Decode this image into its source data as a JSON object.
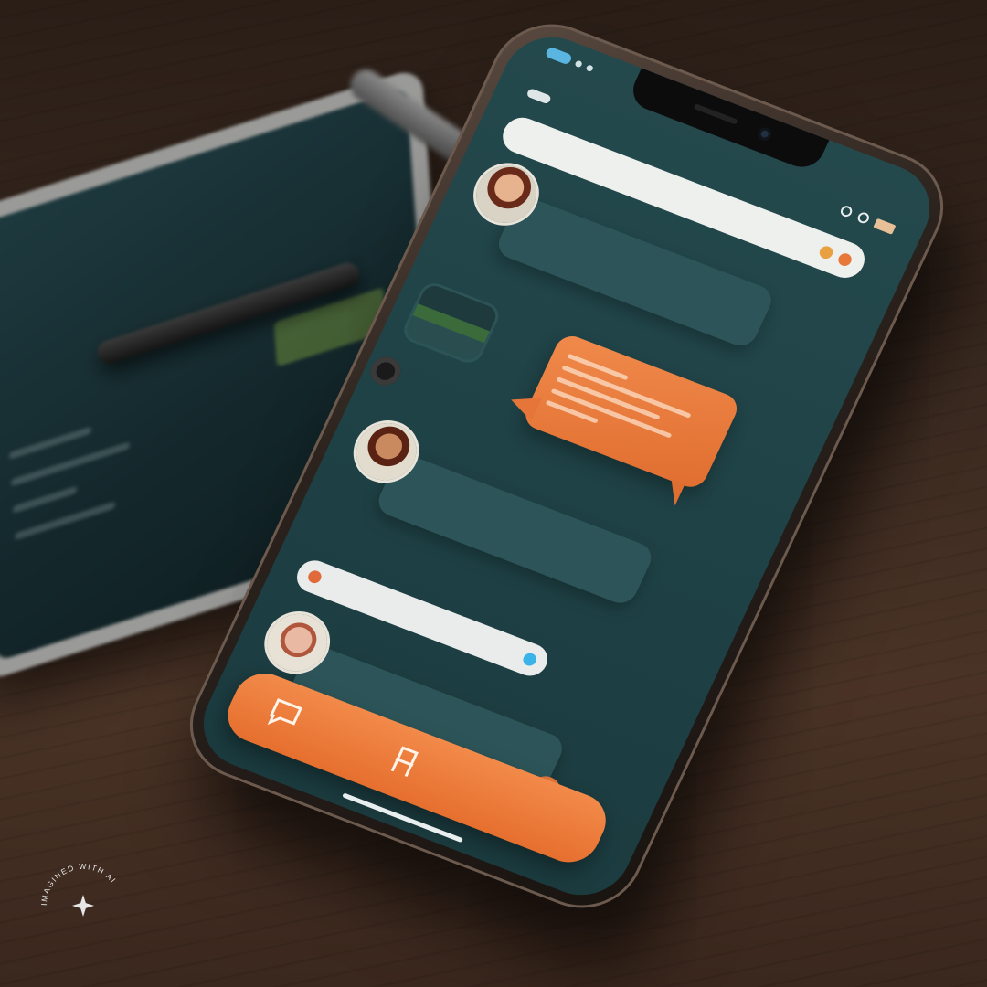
{
  "screen": {
    "search": {
      "placeholder": ""
    },
    "contacts": [
      {
        "name": "",
        "subtitle": ""
      },
      {
        "name": "",
        "subtitle": ""
      },
      {
        "name": "",
        "subtitle": ""
      }
    ],
    "composer": {
      "placeholder": ""
    },
    "section_label": "",
    "nav": {
      "label": ""
    }
  },
  "watermark": {
    "text": "IMAGINED WITH AI"
  },
  "colors": {
    "accent": "#E8773A",
    "screen_bg": "#1F4246",
    "bubble_bg": "#2D5559",
    "table": "#3B2A20"
  },
  "icons": [
    "chat-icon",
    "chair-icon",
    "camera-icon",
    "sparkle-icon"
  ]
}
